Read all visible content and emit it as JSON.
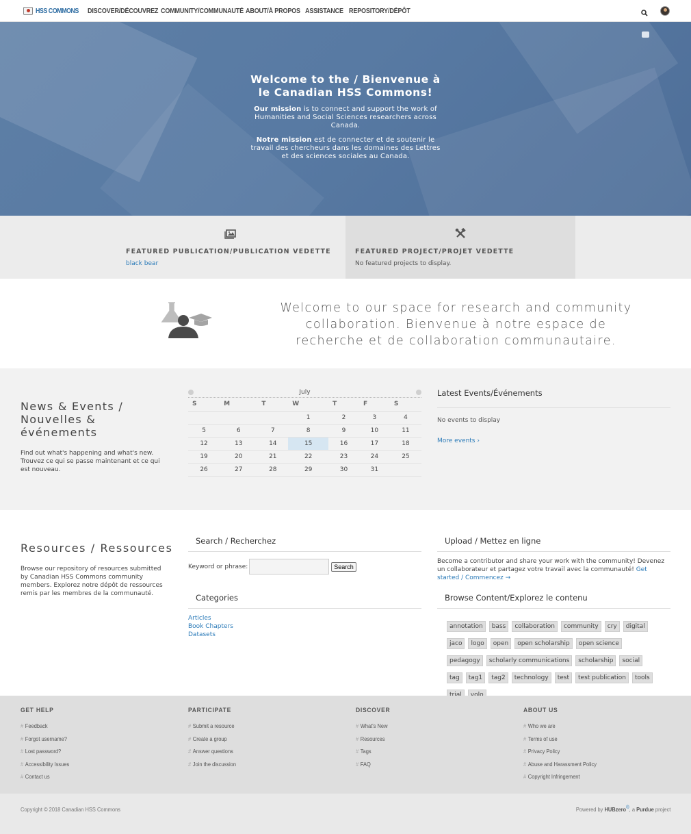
{
  "header": {
    "logo_text": "HSS COMMONS",
    "nav": [
      "DISCOVER/DÉCOUVREZ",
      "COMMUNITY/COMMUNAUTÉ",
      "ABOUT/À PROPOS",
      "ASSISTANCE",
      "REPOSITORY/DÉPÔT"
    ]
  },
  "hero": {
    "title": "Welcome to the / Bienvenue à le Canadian HSS Commons!",
    "mission_en_bold": "Our mission",
    "mission_en_rest": " is to connect and support the work of Humanities and Social Sciences researchers across Canada.",
    "mission_fr_bold": "Notre mission",
    "mission_fr_rest": " est de connecter et de soutenir le travail des chercheurs dans les domaines des Lettres et des sciences sociales au Canada."
  },
  "featured": {
    "publication": {
      "heading": "FEATURED PUBLICATION/PUBLICATION VEDETTE",
      "link": "black bear"
    },
    "project": {
      "heading": "FEATURED PROJECT/PROJET VEDETTE",
      "text": "No featured projects to display."
    }
  },
  "welcome": {
    "text": "Welcome to our space for research and community collaboration. Bienvenue à notre espace de recherche et de collaboration communautaire."
  },
  "news": {
    "title": "News & Events / Nouvelles & événements",
    "description": "Find out what's happening and what's new. Trouvez ce qui se passe maintenant et ce qui est nouveau.",
    "calendar": {
      "month": "July",
      "weekdays": [
        "S",
        "M",
        "T",
        "W",
        "T",
        "F",
        "S"
      ],
      "weeks": [
        [
          "",
          "",
          "",
          "1",
          "2",
          "3",
          "4"
        ],
        [
          "5",
          "6",
          "7",
          "8",
          "9",
          "10",
          "11"
        ],
        [
          "12",
          "13",
          "14",
          "15",
          "16",
          "17",
          "18"
        ],
        [
          "19",
          "20",
          "21",
          "22",
          "23",
          "24",
          "25"
        ],
        [
          "26",
          "27",
          "28",
          "29",
          "30",
          "31",
          ""
        ]
      ],
      "today": "15"
    },
    "latest": {
      "title": "Latest Events/Événements",
      "empty": "No events to display",
      "more": "More events ›"
    }
  },
  "resources": {
    "title": "Resources / Ressources",
    "description": "Browse our repository of resources submitted by Canadian HSS Commons community members. Explorez notre dépôt de ressources remis par les membres de la communauté.",
    "search": {
      "title": "Search / Recherchez",
      "label": "Keyword or phrase:",
      "value": "",
      "button": "Search"
    },
    "categories": {
      "title": "Categories",
      "items": [
        "Articles",
        "Book Chapters",
        "Datasets"
      ]
    },
    "upload": {
      "title": "Upload / Mettez en ligne",
      "text": "Become a contributor and share your work with the community! Devenez un collaborateur et partagez votre travail avec la communauté!",
      "link": "Get started / Commencez →"
    },
    "browse": {
      "title": "Browse Content/Explorez le contenu",
      "tags": [
        "annotation",
        "bass",
        "collaboration",
        "community",
        "cry",
        "digital",
        "jaco",
        "logo",
        "open",
        "open scholarship",
        "open science",
        "pedagogy",
        "scholarly communications",
        "scholarship",
        "social",
        "tag",
        "tag1",
        "tag2",
        "technology",
        "test",
        "test publication",
        "tools",
        "trial",
        "yolo"
      ]
    }
  },
  "footer": {
    "columns": [
      {
        "title": "GET HELP",
        "links": [
          "Feedback",
          "Forgot username?",
          "Lost password?",
          "Accessibility Issues",
          "Contact us"
        ]
      },
      {
        "title": "PARTICIPATE",
        "links": [
          "Submit a resource",
          "Create a group",
          "Answer questions",
          "Join the discussion"
        ]
      },
      {
        "title": "DISCOVER",
        "links": [
          "What's New",
          "Resources",
          "Tags",
          "FAQ"
        ]
      },
      {
        "title": "ABOUT US",
        "links": [
          "Who we are",
          "Terms of use",
          "Privacy Policy",
          "Abuse and Harassment Policy",
          "Copyright Infringement"
        ]
      }
    ],
    "copyright": "Copyright © 2018 Canadian HSS Commons",
    "powered_prefix": "Powered by",
    "powered_hub": "HUBzero",
    "powered_reg": "®",
    "powered_mid": ", a",
    "powered_purdue": "Purdue",
    "powered_suffix": "project"
  },
  "colors": {
    "hero": "#587aa3",
    "link": "#2a7ab8",
    "featured_bg": "#ececec",
    "footer_bg": "#dedede"
  },
  "icons": [
    "search-icon",
    "avatar",
    "toolbox-icon",
    "image-icon",
    "tools-icon",
    "scholar-icon",
    "calendar-prev-icon",
    "calendar-next-icon"
  ]
}
